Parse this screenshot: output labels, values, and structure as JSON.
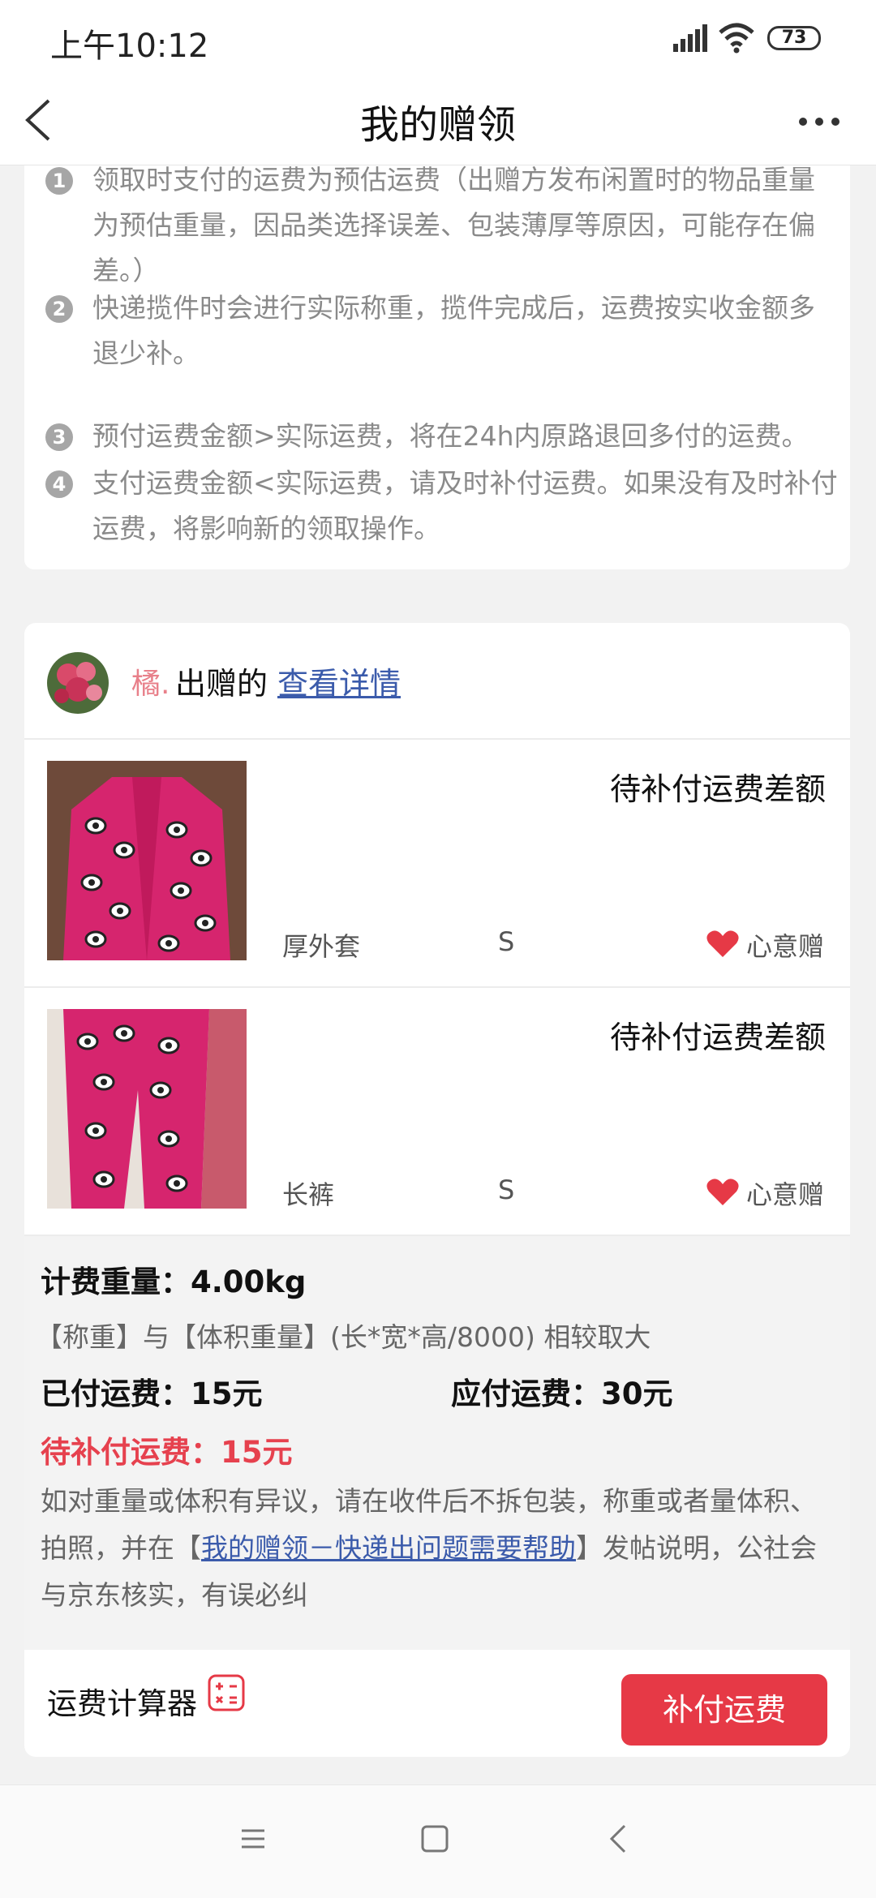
{
  "status_bar": {
    "time": "上午10:12",
    "battery": "73"
  },
  "header": {
    "title": "我的赠领"
  },
  "notice": {
    "items": [
      {
        "num": "1",
        "text": "领取时支付的运费为预估运费（出赠方发布闲置时的物品重量为预估重量，因品类选择误差、包装薄厚等原因，可能存在偏差。）"
      },
      {
        "num": "2",
        "text": "快递揽件时会进行实际称重，揽件完成后，运费按实收金额多退少补。"
      },
      {
        "num": "3",
        "text": "预付运费金额>实际运费，将在24h内原路退回多付的运费。"
      },
      {
        "num": "4",
        "text": "支付运费金额<实际运费，请及时补付运费。如果没有及时补付运费，将影响新的领取操作。"
      }
    ]
  },
  "giver": {
    "name": "橘.",
    "action": "出赠的",
    "link": "查看详情"
  },
  "items": [
    {
      "status": "待补付运费差额",
      "name": "厚外套",
      "size": "S",
      "tag": "心意赠"
    },
    {
      "status": "待补付运费差额",
      "name": "长裤",
      "size": "S",
      "tag": "心意赠"
    }
  ],
  "fee": {
    "weight": "计费重量：4.00kg",
    "rule": "【称重】与【体积重量】(长*宽*高/8000) 相较取大",
    "paid": "已付运费：15元",
    "due": "应付运费：30元",
    "owed": "待补付运费：15元",
    "note_before": "如对重量或体积有异议，请在收件后不拆包装，称重或者量体积、拍照，并在【",
    "note_link": "我的赠领－快递出问题需要帮助",
    "note_after": "】发帖说明，公社会与京东核实，有误必纠"
  },
  "footer": {
    "calc_label": "运费计算器",
    "pay_button": "补付运费"
  },
  "colors": {
    "accent": "#e63946",
    "link": "#3b5bab",
    "product": "#d6256e"
  }
}
